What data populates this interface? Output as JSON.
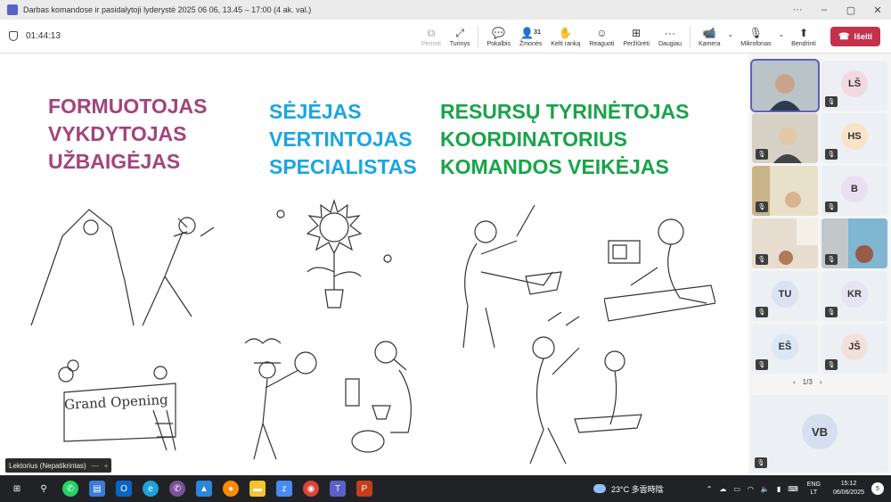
{
  "window": {
    "title": "Darbas komandose ir pasidalytoji lyderystė 2025 06 06, 13.45 – 17:00 (4 ak. val.)",
    "controls": [
      "···",
      "–",
      "▢",
      "✕"
    ]
  },
  "meeting": {
    "timer": "01:44:13",
    "toolbar": {
      "perimti": "Perimti",
      "turinys": "Turinys",
      "pokalbis": "Pokalbis",
      "zmones": "Žmonės",
      "zmones_count": "31",
      "kelti_ranka": "Kelti ranką",
      "reaguoti": "Reaguoti",
      "perziureti": "Peržiūrėti",
      "daugiau": "Daugiau",
      "kamera": "Kamera",
      "mikrofonas": "Mikrofonas",
      "bendrinti": "Bendrinti",
      "iseiti": "Išeiti"
    }
  },
  "slide": {
    "group1": [
      "FORMUOTOJAS",
      "VYKDYTOJAS",
      "UŽBAIGĖJAS"
    ],
    "group2": [
      "SĖJĖJAS",
      "VERTINTOJAS",
      "SPECIALISTAS"
    ],
    "group3": [
      "RESURSŲ TYRINĖTOJAS",
      "KOORDINATORIUS",
      "KOMANDOS VEIKĖJAS"
    ],
    "banner_text": "Grand Opening",
    "colors": {
      "group1": "#a3447e",
      "group2": "#1ba6e0",
      "group3": "#1aa34a"
    }
  },
  "presenter_label": "Lektorius (Nepatikrintas)",
  "participants": [
    {
      "initials": "",
      "video": true
    },
    {
      "initials": "LŠ",
      "color": "#f2d9e1"
    },
    {
      "initials": "",
      "video": true
    },
    {
      "initials": "HS",
      "color": "#f8e3c9"
    },
    {
      "initials": "",
      "video": true
    },
    {
      "initials": "B",
      "color": "#e8dff0"
    },
    {
      "initials": "",
      "video": true
    },
    {
      "initials": "",
      "video": true
    },
    {
      "initials": "TU",
      "color": "#dbe3f3"
    },
    {
      "initials": "KR",
      "color": "#e6e3f3"
    },
    {
      "initials": "EŠ",
      "color": "#dbe7f3"
    },
    {
      "initials": "JŠ",
      "color": "#f2e1d9"
    }
  ],
  "pager": "1/3",
  "big_tile_initials": "VB",
  "taskbar": {
    "weather": "23°C 多雲時陰",
    "lang_top": "ENG",
    "lang_bottom": "LT",
    "time": "15:12",
    "date": "06/06/2025",
    "notifications": "5"
  }
}
